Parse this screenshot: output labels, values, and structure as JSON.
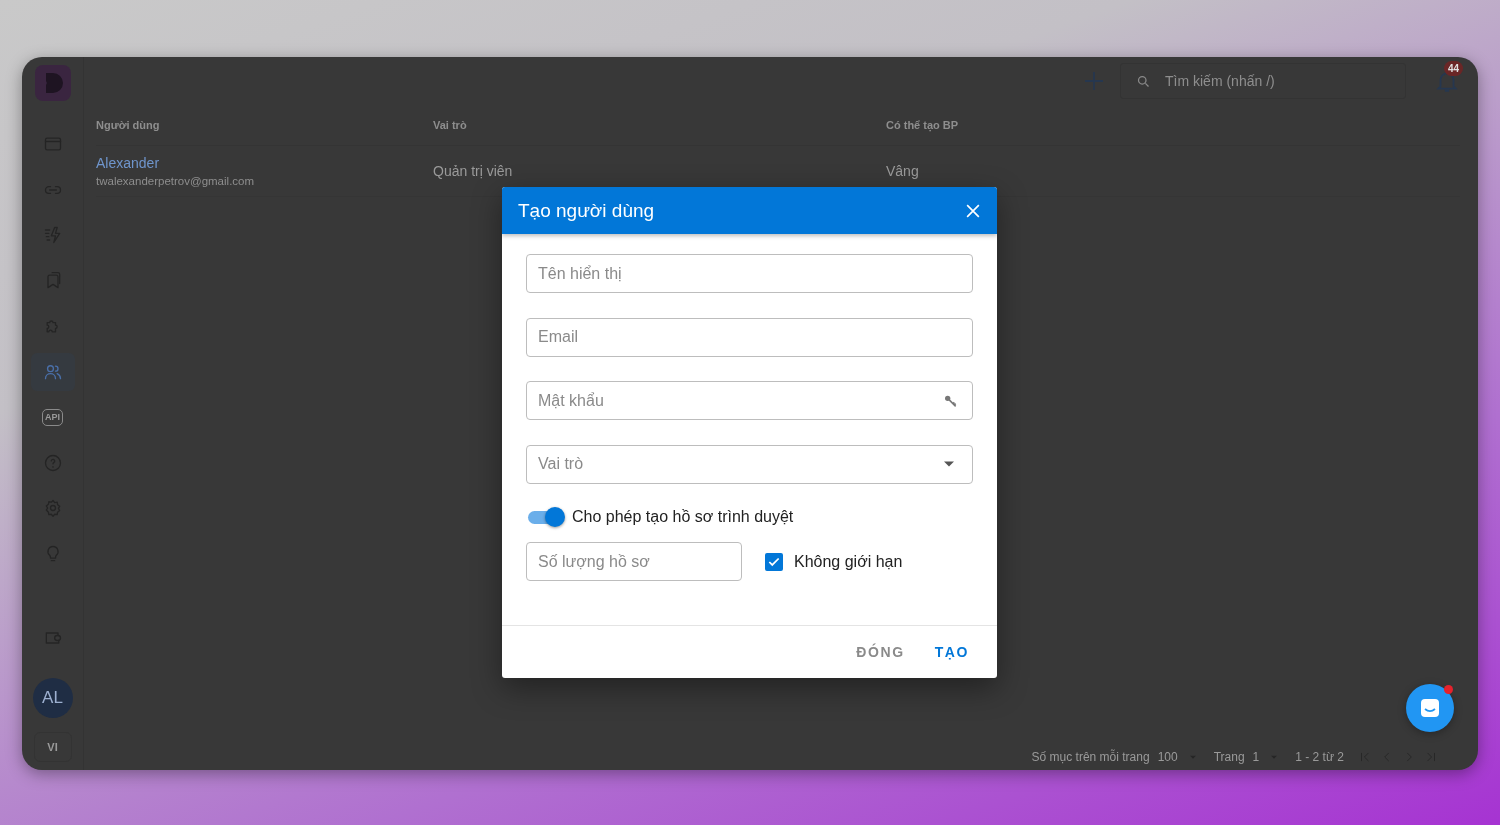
{
  "sidebar": {
    "items": [
      {
        "kind": "card",
        "selected": false
      },
      {
        "kind": "link",
        "selected": false
      },
      {
        "kind": "bolt",
        "selected": false
      },
      {
        "kind": "bookmarks",
        "selected": false
      },
      {
        "kind": "puzzle",
        "selected": false
      },
      {
        "kind": "users",
        "selected": true
      },
      {
        "kind": "api",
        "label": "API",
        "selected": false
      },
      {
        "kind": "help",
        "selected": false
      },
      {
        "kind": "settings",
        "selected": false
      },
      {
        "kind": "bulb",
        "selected": false
      },
      {
        "kind": "wallet",
        "selected": false
      }
    ],
    "avatar": "AL",
    "language": "VI"
  },
  "toolbar": {
    "search": {
      "placeholder": "Tìm kiếm (nhấn /)"
    },
    "notifications": "44"
  },
  "table": {
    "columns": [
      "Người dùng",
      "Vai trò",
      "Có thể tạo BP"
    ],
    "rows": [
      {
        "name": "Alexander",
        "email": "twalexanderpetrov@gmail.com",
        "role": "Quản trị viên",
        "can_create": "Vâng"
      }
    ]
  },
  "pagination": {
    "rows_per_page_label": "Số mục trên mỗi trang",
    "rows_per_page": "100",
    "page_label": "Trang",
    "page": "1",
    "range": "1 - 2 từ 2"
  },
  "dialog": {
    "title": "Tạo người dùng",
    "fields": [
      {
        "kind": "text",
        "placeholder": "Tên hiển thị"
      },
      {
        "kind": "text",
        "placeholder": "Email"
      },
      {
        "kind": "password",
        "placeholder": "Mật khẩu"
      },
      {
        "kind": "select",
        "placeholder": "Vai trò"
      }
    ],
    "toggle": {
      "label": "Cho phép tạo hồ sơ trình duyệt",
      "on": true
    },
    "count_field": {
      "placeholder": "Số lượng hồ sơ"
    },
    "unlimited": {
      "label": "Không giới hạn",
      "checked": true
    },
    "buttons": [
      {
        "label": "ĐÓNG",
        "kind": "secondary"
      },
      {
        "label": "TẠO",
        "kind": "primary"
      }
    ]
  },
  "chat": {
    "unread": true
  }
}
